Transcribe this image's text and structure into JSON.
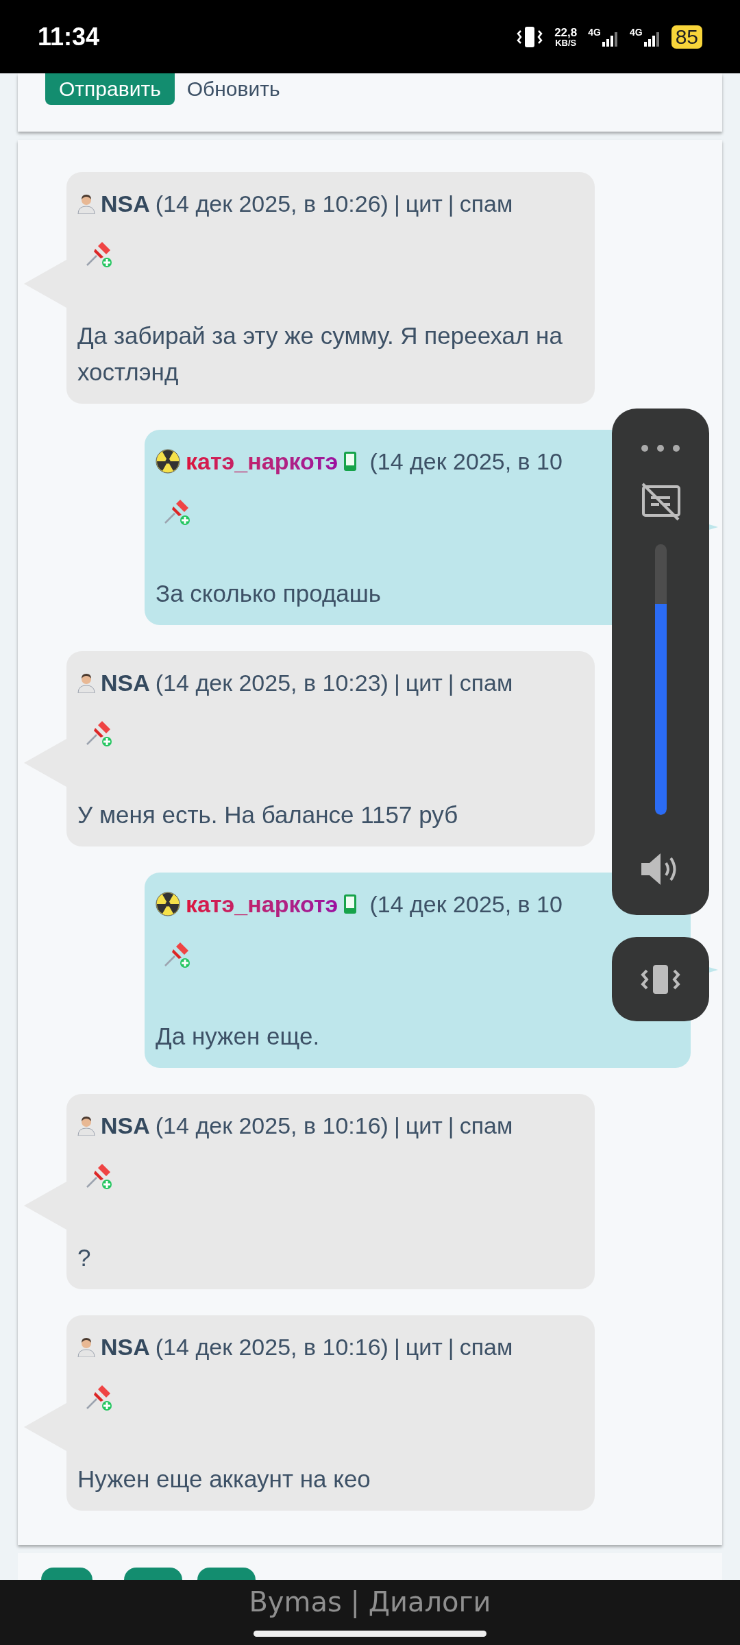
{
  "status_bar": {
    "time": "11:34",
    "net_speed": "22,8",
    "net_unit": "KB/S",
    "signals": [
      "4G",
      "4G"
    ],
    "battery": "85"
  },
  "top_form": {
    "buttons": [
      {
        "label": "Отправить",
        "kind": "primary"
      },
      {
        "label": "Обновить",
        "kind": "link"
      }
    ]
  },
  "messages": [
    {
      "kind": "incoming",
      "author": "NSA",
      "time": "(14 дек 2025, в 10:26)",
      "actions": [
        {
          "separator": "|",
          "label": "цит"
        },
        {
          "separator": "|",
          "label": "спам"
        }
      ],
      "text": "Да забирай за эту же сумму. Я переехал на хостлэнд"
    },
    {
      "kind": "outgoing",
      "author": "катэ_наркотэ",
      "time": "(14 дек 2025, в 10",
      "text": "За сколько продашь"
    },
    {
      "kind": "incoming",
      "author": "NSA",
      "time": "(14 дек 2025, в 10:23)",
      "actions": [
        {
          "separator": "|",
          "label": "цит"
        },
        {
          "separator": "|",
          "label": "спам"
        }
      ],
      "text": "У меня есть. На балансе 1157 руб"
    },
    {
      "kind": "outgoing",
      "author": "катэ_наркотэ",
      "time": "(14 дек 2025, в 10",
      "text": "Да нужен еще."
    },
    {
      "kind": "incoming",
      "author": "NSA",
      "time": "(14 дек 2025, в 10:16)",
      "actions": [
        {
          "separator": "|",
          "label": "цит"
        },
        {
          "separator": "|",
          "label": "спам"
        }
      ],
      "text": "?"
    },
    {
      "kind": "incoming",
      "author": "NSA",
      "time": "(14 дек 2025, в 10:16)",
      "actions": [
        {
          "separator": "|",
          "label": "цит"
        },
        {
          "separator": "|",
          "label": "спам"
        }
      ],
      "text": "Нужен еще аккаунт на кео"
    }
  ],
  "volume_panel": {
    "level": 0.78
  },
  "nav_bar": {
    "title": "Bymas | Диалоги"
  }
}
